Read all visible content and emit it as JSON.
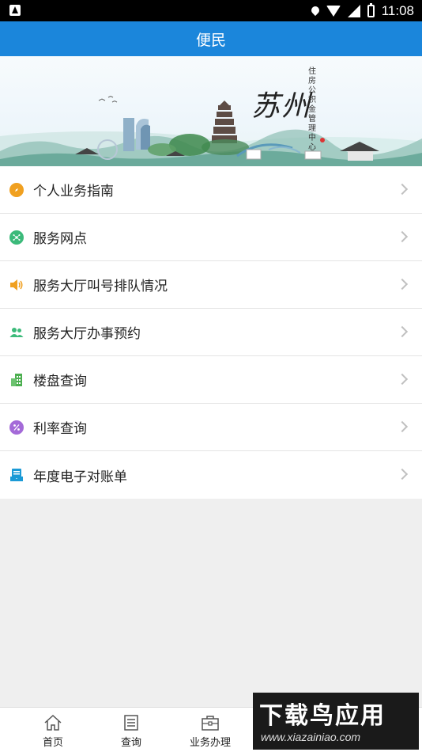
{
  "status_bar": {
    "time": "11:08",
    "icons": [
      "app-notification-icon",
      "location-icon",
      "wifi-icon",
      "signal-icon",
      "battery-icon"
    ]
  },
  "header": {
    "title": "便民"
  },
  "banner": {
    "calligraphy": "苏州",
    "subtitle": "住房公积金管理中心"
  },
  "menu": {
    "items": [
      {
        "label": "个人业务指南",
        "icon": "compass-icon",
        "color": "#f0a020"
      },
      {
        "label": "服务网点",
        "icon": "network-icon",
        "color": "#3cba7a"
      },
      {
        "label": "服务大厅叫号排队情况",
        "icon": "speaker-icon",
        "color": "#f0a020"
      },
      {
        "label": "服务大厅办事预约",
        "icon": "users-icon",
        "color": "#3cba7a"
      },
      {
        "label": "楼盘查询",
        "icon": "building-icon",
        "color": "#4caf50"
      },
      {
        "label": "利率查询",
        "icon": "percent-icon",
        "color": "#a46ad8"
      },
      {
        "label": "年度电子对账单",
        "icon": "statement-icon",
        "color": "#1b9ad6"
      }
    ]
  },
  "bottom_nav": {
    "tabs": [
      {
        "label": "首页",
        "icon": "home-icon"
      },
      {
        "label": "查询",
        "icon": "document-icon"
      },
      {
        "label": "业务办理",
        "icon": "briefcase-icon"
      }
    ]
  },
  "watermark": {
    "title": "下载鸟应用",
    "url": "www.xiazainiao.com"
  },
  "colors": {
    "header_bg": "#1b86db",
    "page_bg": "#efefef"
  }
}
